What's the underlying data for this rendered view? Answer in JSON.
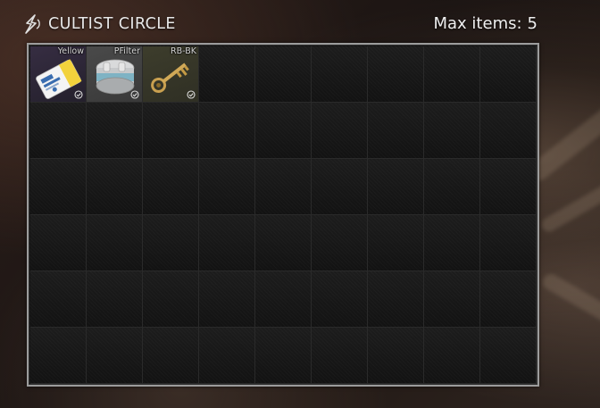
{
  "header": {
    "title": "CULTIST CIRCLE",
    "icon": "cultist-sign-icon",
    "max_items_label": "Max items:",
    "max_items_value": "5"
  },
  "stash": {
    "columns": 9,
    "rows": 6,
    "items": [
      {
        "label": "Yellow",
        "icon": "yellow-keycard-icon",
        "found_in_raid": true,
        "bg_color": "#2c2635"
      },
      {
        "label": "PFilter",
        "icon": "pressure-filter-icon",
        "found_in_raid": true,
        "bg_color": "#3f3f3f"
      },
      {
        "label": "RB-BK",
        "icon": "brass-key-icon",
        "found_in_raid": true,
        "bg_color": "#35352a"
      }
    ]
  },
  "colors": {
    "panel_border": "#9c9c9c",
    "panel_bg": "#141414",
    "text": "#e9e9e9"
  }
}
